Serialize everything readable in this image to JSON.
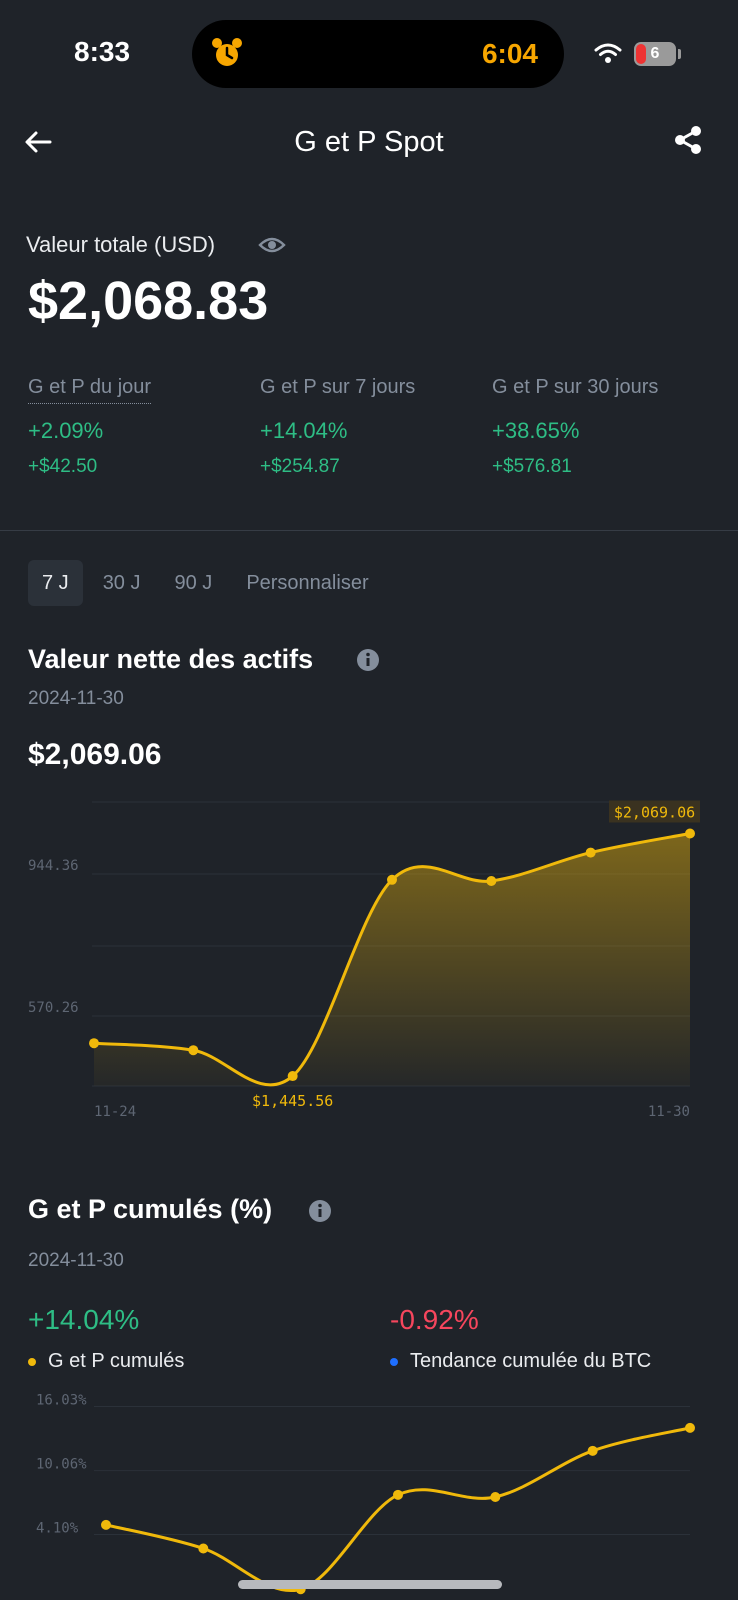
{
  "status_bar": {
    "time": "8:33",
    "timer": "6:04",
    "battery": "6"
  },
  "header": {
    "title": "G et P Spot"
  },
  "summary": {
    "total_label": "Valeur totale (USD)",
    "total_value": "$2,068.83",
    "columns": [
      {
        "label": "G et P du jour",
        "pct": "+2.09%",
        "abs": "+$42.50"
      },
      {
        "label": "G et P sur 7 jours",
        "pct": "+14.04%",
        "abs": "+$254.87"
      },
      {
        "label": "G et P sur 30 jours",
        "pct": "+38.65%",
        "abs": "+$576.81"
      }
    ]
  },
  "tabs": [
    {
      "label": "7 J",
      "active": true
    },
    {
      "label": "30 J",
      "active": false
    },
    {
      "label": "90 J",
      "active": false
    },
    {
      "label": "Personnaliser",
      "active": false
    }
  ],
  "nav": {
    "title": "Valeur nette des actifs",
    "date": "2024-11-30",
    "value": "$2,069.06"
  },
  "cum": {
    "title": "G et P cumulés (%)",
    "date": "2024-11-30",
    "pnl_value": "+14.04%",
    "btc_value": "-0.92%",
    "legend_pnl": "G et P cumulés",
    "legend_btc": "Tendance cumulée du BTC"
  },
  "colors": {
    "accent": "#f0b90b",
    "up": "#2ebd85",
    "down": "#f6465d",
    "btc": "#1e6fff",
    "background": "#1f2329"
  },
  "chart_data": [
    {
      "type": "area",
      "title": "Valeur nette des actifs",
      "x": [
        "11-24",
        "11-25",
        "11-26",
        "11-27",
        "11-28",
        "11-29",
        "11-30"
      ],
      "x_tick_labels": [
        "11-24",
        "11-30"
      ],
      "y_tick_labels": [
        "944.36",
        "570.26"
      ],
      "series": [
        {
          "values": [
            1530,
            1512,
            1445.56,
            1950,
            1947,
            2020,
            2069.06
          ]
        }
      ],
      "annotations": [
        {
          "x": "11-30",
          "label": "$2,069.06"
        },
        {
          "x": "11-26",
          "label": "$1,445.56"
        }
      ],
      "ylim": [
        1420,
        2150
      ],
      "grid": true
    },
    {
      "type": "line",
      "title": "G et P cumulés (%)",
      "x": [
        "11-24",
        "11-25",
        "11-26",
        "11-27",
        "11-28",
        "11-29",
        "11-30"
      ],
      "y_tick_labels": [
        "16.03%",
        "10.06%",
        "4.10%"
      ],
      "series": [
        {
          "name": "G et P cumulés",
          "values": [
            5.0,
            2.8,
            -1.0,
            7.8,
            7.6,
            11.9,
            14.04
          ]
        }
      ],
      "ylim": [
        -2,
        18.5
      ],
      "grid": true
    }
  ]
}
